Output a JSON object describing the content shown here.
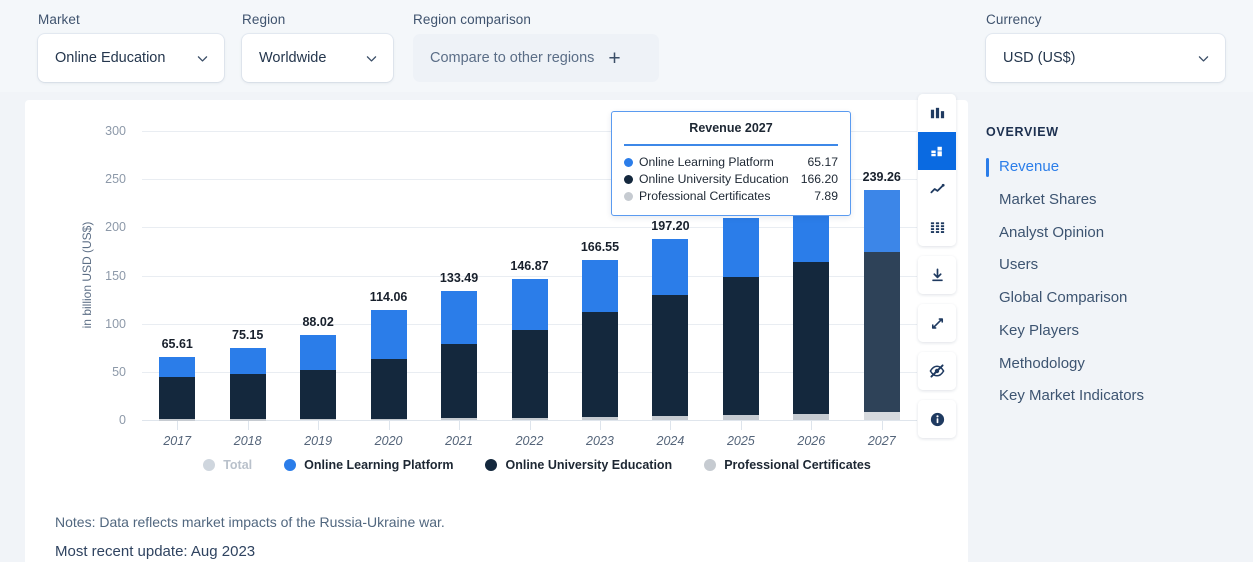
{
  "filters": {
    "market": {
      "label": "Market",
      "value": "Online Education"
    },
    "region": {
      "label": "Region",
      "value": "Worldwide"
    },
    "compare": {
      "label": "Region comparison",
      "value": "Compare to other regions"
    },
    "currency": {
      "label": "Currency",
      "value": "USD (US$)"
    }
  },
  "chart_data": {
    "type": "bar",
    "stacked": true,
    "title": "",
    "xlabel": "",
    "ylabel": "in billion USD (US$)",
    "ylim": [
      0,
      300
    ],
    "yticks": [
      0,
      50,
      100,
      150,
      200,
      250,
      300
    ],
    "grid": true,
    "legend_position": "bottom",
    "categories": [
      "2017",
      "2018",
      "2019",
      "2020",
      "2021",
      "2022",
      "2023",
      "2024",
      "2025",
      "2026",
      "2027"
    ],
    "series": [
      {
        "name": "Professional Certificates",
        "color": "#c6cbd1",
        "values": [
          0.55,
          0.75,
          1.05,
          1.4,
          1.9,
          2.55,
          3.3,
          4.2,
          5.25,
          6.45,
          7.89
        ]
      },
      {
        "name": "Online University Education",
        "color": "#14283d",
        "values": [
          44.0,
          47.1,
          50.7,
          62.3,
          76.8,
          90.4,
          108.7,
          126.0,
          143.4,
          157.5,
          166.2
        ]
      },
      {
        "name": "Online Learning Platform",
        "color": "#2b7de9",
        "values": [
          21.06,
          27.3,
          36.27,
          50.36,
          54.79,
          53.92,
          54.55,
          58.0,
          61.2,
          63.3,
          65.17
        ]
      }
    ],
    "totals": [
      "65.61",
      "75.15",
      "88.02",
      "114.06",
      "133.49",
      "146.87",
      "166.55",
      "197.20",
      "209.85",
      "227.25",
      "239.26"
    ],
    "highlighted_category": "2027",
    "legend": [
      {
        "label": "Total",
        "color": "#cfd6de",
        "enabled": false
      },
      {
        "label": "Online Learning Platform",
        "color": "#2b7de9",
        "enabled": true
      },
      {
        "label": "Online University Education",
        "color": "#14283d",
        "enabled": true
      },
      {
        "label": "Professional Certificates",
        "color": "#c6cbd1",
        "enabled": true
      }
    ]
  },
  "tooltip": {
    "title": "Revenue 2027",
    "rows": [
      {
        "name": "Online Learning Platform",
        "value": "65.17",
        "color": "#2b7de9"
      },
      {
        "name": "Online University Education",
        "value": "166.20",
        "color": "#14283d"
      },
      {
        "name": "Professional Certificates",
        "value": "7.89",
        "color": "#c6cbd1"
      }
    ]
  },
  "toolbar": {
    "groups": [
      [
        {
          "icon": "column-chart-icon",
          "active": false
        },
        {
          "icon": "stacked-bar-icon",
          "active": true
        },
        {
          "icon": "line-chart-icon",
          "active": false
        },
        {
          "icon": "table-grid-icon",
          "active": false
        }
      ],
      [
        {
          "icon": "download-icon",
          "active": false
        }
      ],
      [
        {
          "icon": "expand-icon",
          "active": false
        }
      ],
      [
        {
          "icon": "eye-off-icon",
          "active": false
        }
      ],
      [
        {
          "icon": "info-icon",
          "active": false
        }
      ]
    ]
  },
  "rightnav": {
    "heading": "OVERVIEW",
    "items": [
      {
        "label": "Revenue",
        "active": true
      },
      {
        "label": "Market Shares",
        "active": false
      },
      {
        "label": "Analyst Opinion",
        "active": false
      },
      {
        "label": "Users",
        "active": false
      },
      {
        "label": "Global Comparison",
        "active": false
      },
      {
        "label": "Key Players",
        "active": false
      },
      {
        "label": "Methodology",
        "active": false
      },
      {
        "label": "Key Market Indicators",
        "active": false
      }
    ]
  },
  "notes": {
    "line1": "Notes: Data reflects market impacts of the Russia-Ukraine war.",
    "line2": "Most recent update: Aug 2023"
  },
  "colors": {
    "accent": "#2b7de9",
    "navy": "#14283d",
    "gray": "#c6cbd1",
    "page_bg": "#f1f4f8"
  }
}
